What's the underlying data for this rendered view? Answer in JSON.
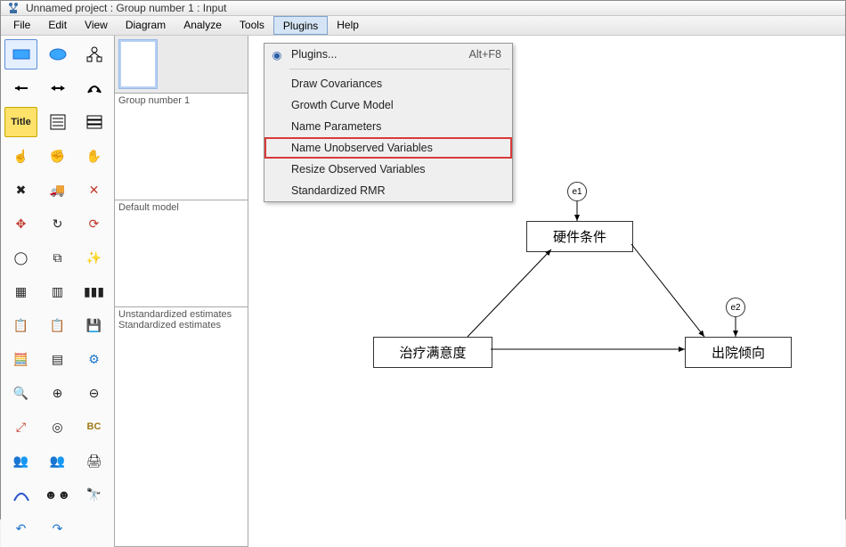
{
  "window": {
    "title": "Unnamed project : Group number 1 : Input"
  },
  "menu": {
    "items": [
      "File",
      "Edit",
      "View",
      "Diagram",
      "Analyze",
      "Tools",
      "Plugins",
      "Help"
    ],
    "active": "Plugins"
  },
  "plugins_menu": {
    "top": {
      "label": "Plugins...",
      "shortcut": "Alt+F8"
    },
    "items": [
      "Draw Covariances",
      "Growth Curve Model",
      "Name Parameters",
      "Name Unobserved Variables",
      "Resize Observed Variables",
      "Standardized RMR"
    ],
    "highlight_index": 3
  },
  "panes": {
    "group": "Group number 1",
    "model": "Default model",
    "estimates": [
      "Unstandardized estimates",
      "Standardized estimates"
    ]
  },
  "diagram": {
    "e1": "e1",
    "e2": "e2",
    "box_top": "硬件条件",
    "box_left": "治疗满意度",
    "box_right": "出院倾向"
  },
  "tools": [
    "rect",
    "ellipse",
    "latent",
    "arrow-left",
    "arrow-both",
    "cov-arc",
    "title",
    "list",
    "rows",
    "hand",
    "grab",
    "hand-open",
    "erase-x",
    "truck",
    "x",
    "fourarrows",
    "loop",
    "loop-multi",
    "lasso",
    "copy",
    "magic",
    "grid",
    "tally",
    "barcode",
    "clip",
    "clipboard",
    "save-disk",
    "abacus",
    "props",
    "gears",
    "zoom-search",
    "zoom-in",
    "zoom-out",
    "expand",
    "target-bc",
    "bc",
    "people3",
    "people-grp",
    "printer",
    "dist",
    "faces",
    "binoc",
    "undo",
    "redo"
  ]
}
